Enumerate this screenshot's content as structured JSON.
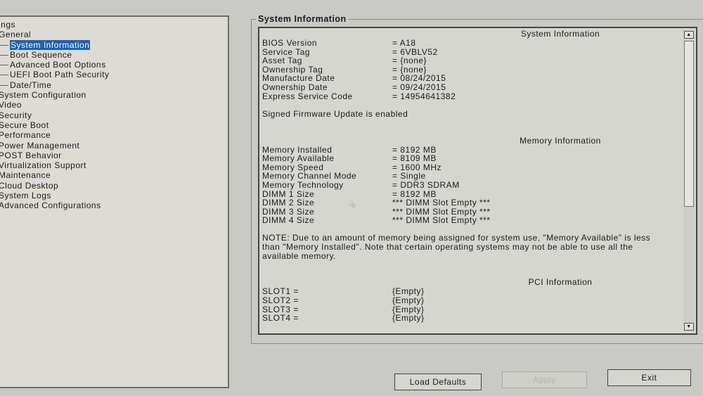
{
  "tree": [
    {
      "label": "ings",
      "sub": false
    },
    {
      "label": "General",
      "sub": false
    },
    {
      "label": "System Information",
      "sub": true,
      "selected": true
    },
    {
      "label": "Boot Sequence",
      "sub": true
    },
    {
      "label": "Advanced Boot Options",
      "sub": true
    },
    {
      "label": "UEFI Boot Path Security",
      "sub": true
    },
    {
      "label": "Date/Time",
      "sub": true
    },
    {
      "label": "System Configuration",
      "sub": false
    },
    {
      "label": "Video",
      "sub": false
    },
    {
      "label": "Security",
      "sub": false
    },
    {
      "label": "Secure Boot",
      "sub": false
    },
    {
      "label": "Performance",
      "sub": false
    },
    {
      "label": "Power Management",
      "sub": false
    },
    {
      "label": "POST Behavior",
      "sub": false
    },
    {
      "label": "Virtualization Support",
      "sub": false
    },
    {
      "label": "Maintenance",
      "sub": false
    },
    {
      "label": "Cloud Desktop",
      "sub": false
    },
    {
      "label": "System Logs",
      "sub": false
    },
    {
      "label": "Advanced Configurations",
      "sub": false
    }
  ],
  "group_title": "System Information",
  "sysinfo": {
    "header": "System Information",
    "rows": [
      {
        "label": "BIOS Version",
        "value": "= A18"
      },
      {
        "label": "Service Tag",
        "value": "= 6VBLV52"
      },
      {
        "label": "Asset Tag",
        "value": "= {none}"
      },
      {
        "label": "Ownership Tag",
        "value": "= {none}"
      },
      {
        "label": "Manufacture Date",
        "value": "= 08/24/2015"
      },
      {
        "label": "Ownership Date",
        "value": "= 09/24/2015"
      },
      {
        "label": "Express Service Code",
        "value": "= 14954641382"
      }
    ],
    "firmware_note": "Signed Firmware Update is enabled"
  },
  "memory": {
    "header": "Memory Information",
    "rows": [
      {
        "label": "Memory Installed",
        "value": "= 8192 MB"
      },
      {
        "label": "Memory Available",
        "value": "= 8109 MB"
      },
      {
        "label": "Memory Speed",
        "value": "= 1600 MHz"
      },
      {
        "label": "Memory Channel Mode",
        "value": "= Single"
      },
      {
        "label": "Memory Technology",
        "value": "= DDR3 SDRAM"
      },
      {
        "label": "DIMM 1 Size",
        "value": "= 8192 MB"
      },
      {
        "label": "DIMM 2 Size",
        "value": "*** DIMM Slot Empty ***"
      },
      {
        "label": "DIMM 3 Size",
        "value": "*** DIMM Slot Empty ***"
      },
      {
        "label": "DIMM 4 Size",
        "value": "*** DIMM Slot Empty ***"
      }
    ],
    "note": "NOTE: Due to an amount of memory being assigned for system use, \"Memory Available\" is less than \"Memory Installed\". Note that certain operating systems may not be able to use all the available memory."
  },
  "pci": {
    "header": "PCI Information",
    "rows": [
      {
        "label": "SLOT1 =",
        "value": "{Empty}"
      },
      {
        "label": "SLOT2 =",
        "value": "{Empty}"
      },
      {
        "label": "SLOT3 =",
        "value": "{Empty}"
      },
      {
        "label": "SLOT4 =",
        "value": "{Empty}"
      }
    ]
  },
  "buttons": {
    "load_defaults": "Load Defaults",
    "apply": "Apply",
    "exit": "Exit"
  }
}
